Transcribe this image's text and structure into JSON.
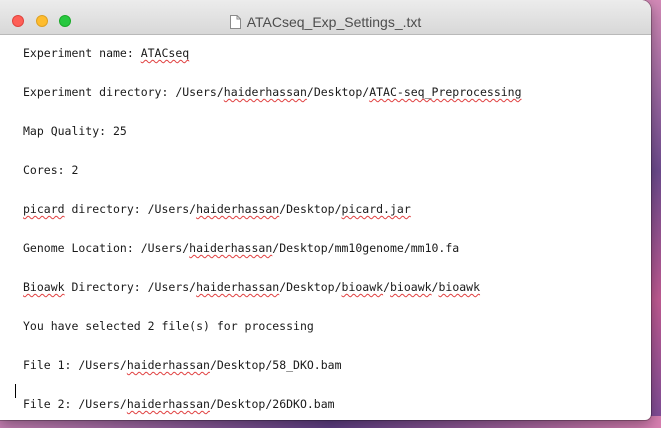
{
  "window": {
    "title": "ATACseq_Exp_Settings_.txt",
    "icon": "document-icon"
  },
  "lines": [
    {
      "label": "Experiment name: ",
      "value": "ATACseq"
    },
    {
      "label": "Experiment directory: /Users/",
      "value": "haiderhassan",
      "rest": "/Desktop/",
      "value2": "ATAC-seq_Preprocessing"
    },
    {
      "label": "Map Quality: 25"
    },
    {
      "label": "Cores: 2"
    },
    {
      "value": "picard",
      "label": " directory: /Users/",
      "value2": "haiderhassan",
      "rest": "/Desktop/",
      "value3": "picard.jar"
    },
    {
      "label": "Genome Location: /Users/",
      "value": "haiderhassan",
      "rest": "/Desktop/mm10genome/mm10.fa"
    },
    {
      "value": "Bioawk",
      "label": " Directory: /Users/",
      "value2": "haiderhassan",
      "rest": "/Desktop/",
      "value3": "bioawk",
      "sep1": "/",
      "value4": "bioawk",
      "sep2": "/",
      "value5": "bioawk"
    },
    {
      "label": "You have selected 2 file(s) for processing"
    },
    {
      "label": "File 1: /Users/",
      "value": "haiderhassan",
      "rest": "/Desktop/58_DKO.bam"
    },
    {
      "label": "File 2: /Users/",
      "value": "haiderhassan",
      "rest": "/Desktop/26DKO.bam"
    }
  ]
}
